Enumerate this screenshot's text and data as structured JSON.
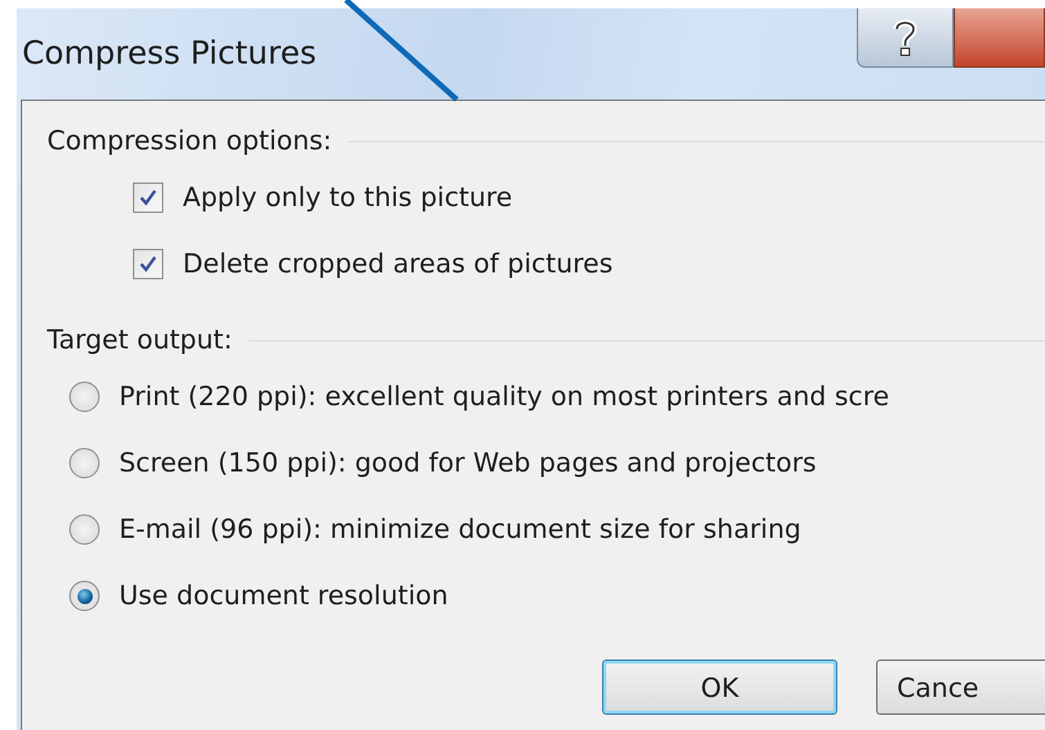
{
  "window": {
    "title": "Compress Pictures",
    "title_buttons": [
      {
        "kind": "help"
      },
      {
        "kind": "close"
      }
    ]
  },
  "groups": [
    {
      "label": "Compression options:",
      "items": [
        {
          "kind": "checkbox",
          "label": "Apply only to this picture",
          "checked": true
        },
        {
          "kind": "checkbox",
          "label": "Delete cropped areas of pictures",
          "checked": true
        }
      ]
    },
    {
      "label": "Target output:",
      "items": [
        {
          "kind": "radio",
          "label": "Print (220 ppi): excellent quality on most printers and scre",
          "selected": false
        },
        {
          "kind": "radio",
          "label": "Screen (150 ppi): good for Web pages and projectors",
          "selected": false
        },
        {
          "kind": "radio",
          "label": "E-mail (96 ppi): minimize document size for sharing",
          "selected": false
        },
        {
          "kind": "radio",
          "label": "Use document resolution",
          "selected": true
        }
      ]
    }
  ],
  "buttons": [
    {
      "label": "OK",
      "default": true
    },
    {
      "label": "Cance",
      "default": false
    }
  ]
}
